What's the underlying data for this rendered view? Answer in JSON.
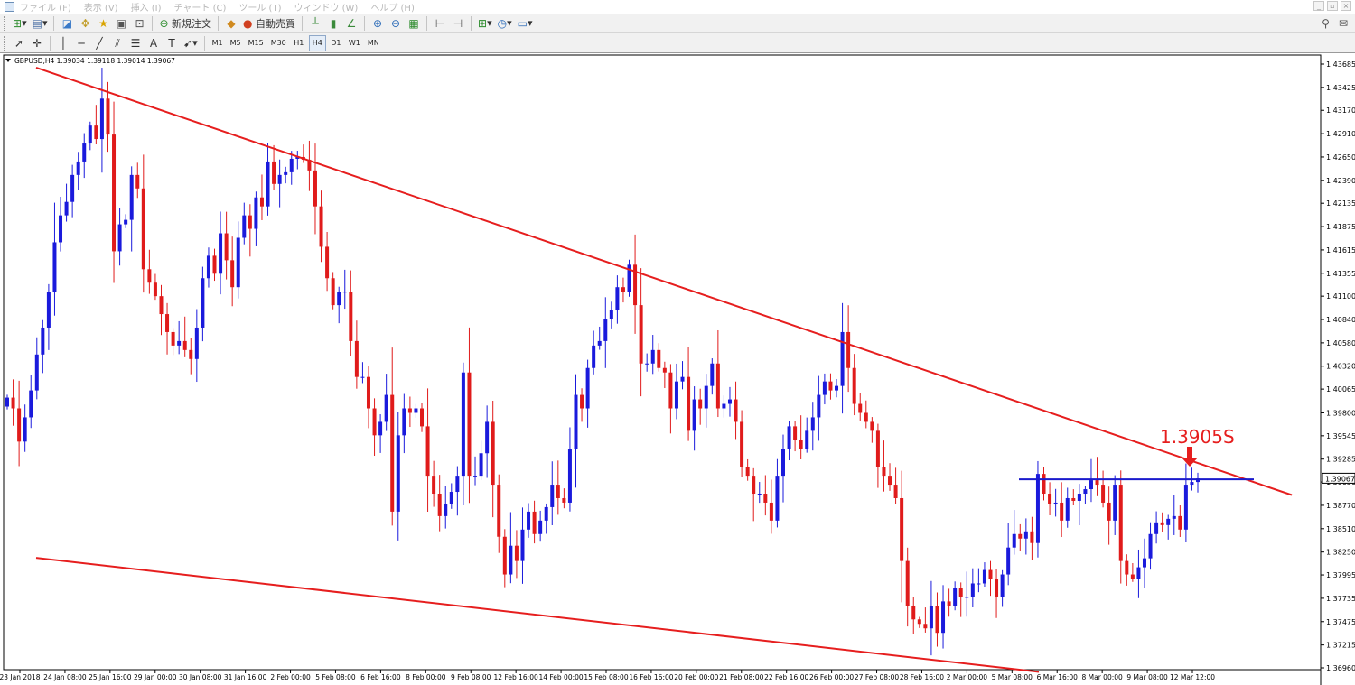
{
  "menu": [
    "ファイル (F)",
    "表示 (V)",
    "挿入 (I)",
    "チャート (C)",
    "ツール (T)",
    "ウィンドウ (W)",
    "ヘルプ (H)"
  ],
  "toolbar": {
    "new_order_label": "新規注文",
    "auto_trade_label": "自動売買"
  },
  "periods": [
    "M1",
    "M5",
    "M15",
    "M30",
    "H1",
    "H4",
    "D1",
    "W1",
    "MN"
  ],
  "active_period": "H4",
  "chart_data": {
    "type": "candlestick",
    "header": "GBPUSD,H4  1.39034 1.39118 1.39014 1.39067",
    "ylim": [
      1.3696,
      1.43685
    ],
    "y_ticks": [
      "1.43685",
      "1.43425",
      "1.43170",
      "1.42910",
      "1.42650",
      "1.42390",
      "1.42135",
      "1.41875",
      "1.41615",
      "1.41355",
      "1.41100",
      "1.40840",
      "1.40580",
      "1.40320",
      "1.40065",
      "1.39800",
      "1.39545",
      "1.39285",
      "1.39030",
      "1.38770",
      "1.38510",
      "1.38250",
      "1.37995",
      "1.37735",
      "1.37475",
      "1.37215",
      "1.36960"
    ],
    "x_ticks": [
      "23 Jan 2018",
      "24 Jan 08:00",
      "25 Jan 16:00",
      "29 Jan 00:00",
      "30 Jan 08:00",
      "31 Jan 16:00",
      "2 Feb 00:00",
      "5 Feb 08:00",
      "6 Feb 16:00",
      "8 Feb 00:00",
      "9 Feb 08:00",
      "12 Feb 16:00",
      "14 Feb 00:00",
      "15 Feb 08:00",
      "16 Feb 16:00",
      "20 Feb 00:00",
      "21 Feb 08:00",
      "22 Feb 16:00",
      "26 Feb 00:00",
      "27 Feb 08:00",
      "28 Feb 16:00",
      "2 Mar 00:00",
      "5 Mar 08:00",
      "6 Mar 16:00",
      "8 Mar 00:00",
      "9 Mar 08:00",
      "12 Mar 12:00"
    ],
    "current_price": "1.39067",
    "annotation": "1.3905S",
    "up_color": "#1a1adc",
    "down_color": "#e01b1b",
    "closes": [
      1.3997,
      1.3985,
      1.3948,
      1.3975,
      1.4005,
      1.4045,
      1.4075,
      1.4115,
      1.417,
      1.42,
      1.4215,
      1.4245,
      1.426,
      1.428,
      1.43,
      1.4285,
      1.433,
      1.429,
      1.416,
      1.419,
      1.4195,
      1.4245,
      1.423,
      1.414,
      1.4125,
      1.411,
      1.409,
      1.407,
      1.4055,
      1.406,
      1.405,
      1.404,
      1.4075,
      1.413,
      1.4155,
      1.4135,
      1.418,
      1.415,
      1.412,
      1.4175,
      1.42,
      1.4185,
      1.422,
      1.421,
      1.426,
      1.4235,
      1.4245,
      1.4248,
      1.4263,
      1.4265,
      1.4262,
      1.425,
      1.421,
      1.4165,
      1.413,
      1.41,
      1.4115,
      1.4115,
      1.406,
      1.402,
      1.402,
      1.3985,
      1.3955,
      1.397,
      1.4,
      1.387,
      1.3955,
      1.3985,
      1.398,
      1.3985,
      1.3965,
      1.391,
      1.389,
      1.3865,
      1.3878,
      1.3892,
      1.391,
      1.4025,
      1.391,
      1.391,
      1.3935,
      1.397,
      1.39,
      1.3842,
      1.38,
      1.3832,
      1.3815,
      1.385,
      1.387,
      1.3845,
      1.386,
      1.3875,
      1.39,
      1.3885,
      1.388,
      1.394,
      1.4,
      1.3985,
      1.403,
      1.4055,
      1.406,
      1.4085,
      1.4095,
      1.412,
      1.4115,
      1.4145,
      1.41,
      1.4035,
      1.4035,
      1.405,
      1.403,
      1.4025,
      1.3985,
      1.4015,
      1.402,
      1.396,
      1.3995,
      1.3985,
      1.401,
      1.4035,
      1.3985,
      1.399,
      1.3995,
      1.397,
      1.392,
      1.391,
      1.389,
      1.389,
      1.388,
      1.386,
      1.391,
      1.394,
      1.3965,
      1.395,
      1.394,
      1.396,
      1.3975,
      1.4,
      1.4015,
      1.4005,
      1.401,
      1.407,
      1.403,
      1.399,
      1.398,
      1.397,
      1.396,
      1.392,
      1.391,
      1.39,
      1.3885,
      1.3815,
      1.3765,
      1.375,
      1.3745,
      1.374,
      1.3765,
      1.3735,
      1.377,
      1.3765,
      1.3785,
      1.3775,
      1.3775,
      1.379,
      1.379,
      1.3805,
      1.3795,
      1.3775,
      1.38,
      1.383,
      1.3845,
      1.384,
      1.3848,
      1.3835,
      1.3912,
      1.389,
      1.3878,
      1.388,
      1.386,
      1.3885,
      1.3882,
      1.389,
      1.3895,
      1.3905,
      1.39,
      1.388,
      1.386,
      1.39,
      1.3815,
      1.38,
      1.3795,
      1.3808,
      1.3818,
      1.3845,
      1.3858,
      1.3855,
      1.3862,
      1.3865,
      1.385,
      1.39,
      1.3903,
      1.3907
    ]
  }
}
